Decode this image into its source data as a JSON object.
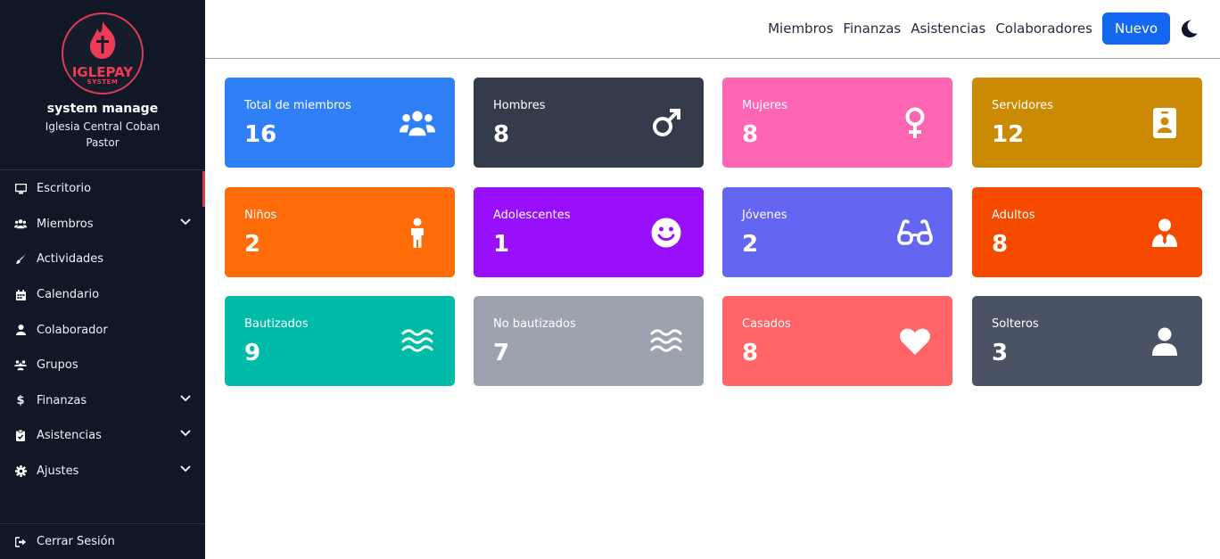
{
  "brand": {
    "logo_text": "IGLEPAY",
    "logo_sub": "SYSTEM",
    "user_name": "system manage",
    "church": "Iglesia Central Coban",
    "role": "Pastor"
  },
  "sidebar": {
    "items": [
      {
        "label": "Escritorio",
        "icon": "desktop-icon",
        "active": true
      },
      {
        "label": "Miembros",
        "icon": "users-icon",
        "has_submenu": true
      },
      {
        "label": "Actividades",
        "icon": "brush-icon"
      },
      {
        "label": "Calendario",
        "icon": "calendar-icon"
      },
      {
        "label": "Colaborador",
        "icon": "user-icon"
      },
      {
        "label": "Grupos",
        "icon": "group-icon"
      },
      {
        "label": "Finanzas",
        "icon": "dollar-icon",
        "has_submenu": true
      },
      {
        "label": "Asistencias",
        "icon": "clipboard-icon",
        "has_submenu": true
      },
      {
        "label": "Ajustes",
        "icon": "gear-icon",
        "has_submenu": true
      }
    ],
    "logout_label": "Cerrar Sesión"
  },
  "topbar": {
    "links": [
      "Miembros",
      "Finanzas",
      "Asistencias",
      "Colaboradores"
    ],
    "new_button": "Nuevo",
    "theme_icon": "moon-icon"
  },
  "cards": [
    {
      "label": "Total de miembros",
      "value": "16",
      "color": "#2f80f7",
      "icon": "users-icon"
    },
    {
      "label": "Hombres",
      "value": "8",
      "color": "#343c4c",
      "icon": "mars-icon"
    },
    {
      "label": "Mujeres",
      "value": "8",
      "color": "#fe66b4",
      "icon": "venus-icon"
    },
    {
      "label": "Servidores",
      "value": "12",
      "color": "#ca8a04",
      "icon": "id-badge-icon"
    },
    {
      "label": "Niños",
      "value": "2",
      "color": "#fe6d0a",
      "icon": "child-icon"
    },
    {
      "label": "Adolescentes",
      "value": "1",
      "color": "#9810fa",
      "icon": "smile-icon"
    },
    {
      "label": "Jóvenes",
      "value": "2",
      "color": "#6366f1",
      "icon": "glasses-icon"
    },
    {
      "label": "Adultos",
      "value": "8",
      "color": "#f54a00",
      "icon": "user-tie-icon"
    },
    {
      "label": "Bautizados",
      "value": "9",
      "color": "#00bba7",
      "icon": "water-icon"
    },
    {
      "label": "No bautizados",
      "value": "7",
      "color": "#9ca3af",
      "icon": "water-icon"
    },
    {
      "label": "Casados",
      "value": "8",
      "color": "#ff6467",
      "icon": "heart-icon"
    },
    {
      "label": "Solteros",
      "value": "3",
      "color": "#4a5365",
      "icon": "user-icon"
    }
  ]
}
